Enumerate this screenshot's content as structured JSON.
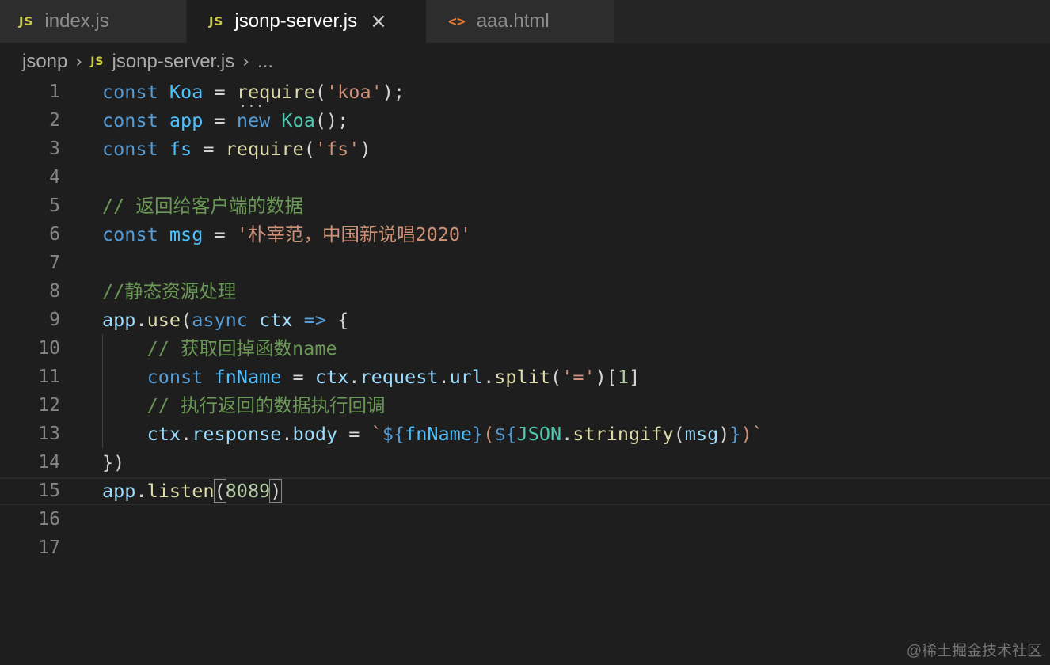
{
  "tabs": [
    {
      "icon": "js-icon",
      "badge": "JS",
      "label": "index.js"
    },
    {
      "icon": "js-icon",
      "badge": "JS",
      "label": "jsonp-server.js",
      "close": "×"
    },
    {
      "icon": "html-icon",
      "badge": "<>",
      "label": "aaa.html"
    }
  ],
  "breadcrumb": {
    "folder": "jsonp",
    "sep": "›",
    "badge": "JS",
    "file": "jsonp-server.js",
    "more": "..."
  },
  "lines": [
    {
      "n": "1",
      "tokens": [
        [
          "kw",
          "const"
        ],
        [
          "pun",
          " "
        ],
        [
          "var",
          "Koa"
        ],
        [
          "pun",
          " = "
        ],
        [
          "fn",
          "require"
        ],
        [
          "pun",
          "("
        ],
        [
          "str",
          "'koa'"
        ],
        [
          "pun",
          ");"
        ]
      ]
    },
    {
      "n": "2",
      "tokens": [
        [
          "kw",
          "const"
        ],
        [
          "pun",
          " "
        ],
        [
          "var",
          "app"
        ],
        [
          "pun",
          " = "
        ],
        [
          "kw",
          "new"
        ],
        [
          "pun",
          " "
        ],
        [
          "cls",
          "Koa"
        ],
        [
          "pun",
          "();"
        ]
      ]
    },
    {
      "n": "3",
      "tokens": [
        [
          "kw",
          "const"
        ],
        [
          "pun",
          " "
        ],
        [
          "var",
          "fs"
        ],
        [
          "pun",
          " = "
        ],
        [
          "fn",
          "require"
        ],
        [
          "pun",
          "("
        ],
        [
          "str",
          "'fs'"
        ],
        [
          "pun",
          ")"
        ]
      ]
    },
    {
      "n": "4",
      "tokens": []
    },
    {
      "n": "5",
      "tokens": [
        [
          "cmt",
          "// 返回给客户端的数据"
        ]
      ]
    },
    {
      "n": "6",
      "tokens": [
        [
          "kw",
          "const"
        ],
        [
          "pun",
          " "
        ],
        [
          "var",
          "msg"
        ],
        [
          "pun",
          " = "
        ],
        [
          "str",
          "'朴宰范，中国新说唱2020'"
        ]
      ]
    },
    {
      "n": "7",
      "tokens": []
    },
    {
      "n": "8",
      "tokens": [
        [
          "cmt",
          "//静态资源处理"
        ]
      ]
    },
    {
      "n": "9",
      "tokens": [
        [
          "prm",
          "app"
        ],
        [
          "pun",
          "."
        ],
        [
          "fn",
          "use"
        ],
        [
          "pun",
          "("
        ],
        [
          "kw",
          "async"
        ],
        [
          "pun",
          " "
        ],
        [
          "prm",
          "ctx"
        ],
        [
          "pun",
          " "
        ],
        [
          "kw",
          "=>"
        ],
        [
          "pun",
          " {"
        ]
      ]
    },
    {
      "n": "10",
      "tokens": [
        [
          "pun",
          "    "
        ],
        [
          "cmt",
          "// 获取回掉函数name"
        ]
      ]
    },
    {
      "n": "11",
      "tokens": [
        [
          "pun",
          "    "
        ],
        [
          "kw",
          "const"
        ],
        [
          "pun",
          " "
        ],
        [
          "var",
          "fnName"
        ],
        [
          "pun",
          " = "
        ],
        [
          "prm",
          "ctx"
        ],
        [
          "pun",
          "."
        ],
        [
          "prm",
          "request"
        ],
        [
          "pun",
          "."
        ],
        [
          "prm",
          "url"
        ],
        [
          "pun",
          "."
        ],
        [
          "fn",
          "split"
        ],
        [
          "pun",
          "("
        ],
        [
          "str",
          "'='"
        ],
        [
          "pun",
          ")["
        ],
        [
          "num",
          "1"
        ],
        [
          "pun",
          "]"
        ]
      ]
    },
    {
      "n": "12",
      "tokens": [
        [
          "pun",
          "    "
        ],
        [
          "cmt",
          "// 执行返回的数据执行回调"
        ]
      ]
    },
    {
      "n": "13",
      "tokens": [
        [
          "pun",
          "    "
        ],
        [
          "prm",
          "ctx"
        ],
        [
          "pun",
          "."
        ],
        [
          "prm",
          "response"
        ],
        [
          "pun",
          "."
        ],
        [
          "prm",
          "body"
        ],
        [
          "pun",
          " = "
        ],
        [
          "str",
          "`"
        ],
        [
          "tpl",
          "${"
        ],
        [
          "var",
          "fnName"
        ],
        [
          "tpl",
          "}"
        ],
        [
          "str",
          "("
        ],
        [
          "tpl",
          "${"
        ],
        [
          "cls",
          "JSON"
        ],
        [
          "pun",
          "."
        ],
        [
          "fn",
          "stringify"
        ],
        [
          "pun",
          "("
        ],
        [
          "prm",
          "msg"
        ],
        [
          "pun",
          ")"
        ],
        [
          "tpl",
          "}"
        ],
        [
          "str",
          ")`"
        ]
      ]
    },
    {
      "n": "14",
      "tokens": [
        [
          "pun",
          "})"
        ]
      ]
    },
    {
      "n": "15",
      "tokens": [
        [
          "prm",
          "app"
        ],
        [
          "pun",
          "."
        ],
        [
          "fn",
          "listen"
        ],
        [
          "bm",
          "("
        ],
        [
          "num",
          "8089"
        ],
        [
          "bm",
          ")"
        ]
      ]
    },
    {
      "n": "16",
      "tokens": []
    },
    {
      "n": "17",
      "tokens": []
    }
  ],
  "hint_dots": "...",
  "watermark": "@稀土掘金技术社区"
}
